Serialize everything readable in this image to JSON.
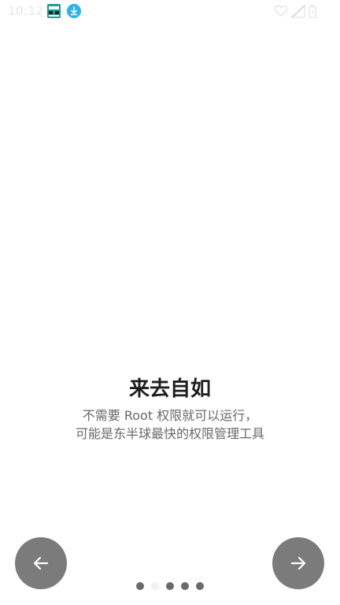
{
  "status_bar": {
    "time": "10:12",
    "icons": [
      "app-icon",
      "download-icon",
      "heart-outline-icon",
      "signal-icon",
      "battery-icon"
    ]
  },
  "onboarding": {
    "title": "来去自如",
    "description_line1": "不需要 Root 权限就可以运行，",
    "description_line2": "可能是东半球最快的权限管理工具"
  },
  "navigation": {
    "prev_icon": "arrow-left-icon",
    "next_icon": "arrow-right-icon"
  },
  "pager": {
    "total": 5,
    "current_index": 1
  },
  "colors": {
    "button": "#7b7b7b",
    "title": "#1e1e1e",
    "description": "#686868"
  }
}
